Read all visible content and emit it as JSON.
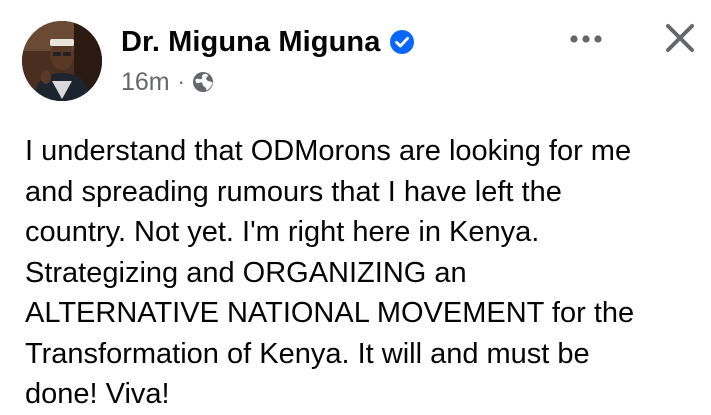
{
  "post": {
    "author": {
      "name": "Dr. Miguna Miguna",
      "avatar_icon": "profile-photo",
      "verified_icon": "verified-badge-icon"
    },
    "meta": {
      "time": "16m",
      "separator": "·",
      "audience_icon": "globe-icon"
    },
    "header_actions": {
      "more_icon": "more-options-icon",
      "close_icon": "close-icon"
    },
    "body_lines": [
      "I understand that ODMorons are looking for me",
      "and spreading rumours that I have left the",
      "country. Not yet. I'm right here in Kenya.",
      "Strategizing and ORGANIZING an",
      "ALTERNATIVE NATIONAL MOVEMENT for the",
      "Transformation of Kenya. It will and must be",
      "done! Viva!"
    ]
  },
  "colors": {
    "text_primary": "#050505",
    "text_secondary": "#65676b",
    "verified_blue": "#0866ff",
    "icon_gray": "#65676b"
  }
}
